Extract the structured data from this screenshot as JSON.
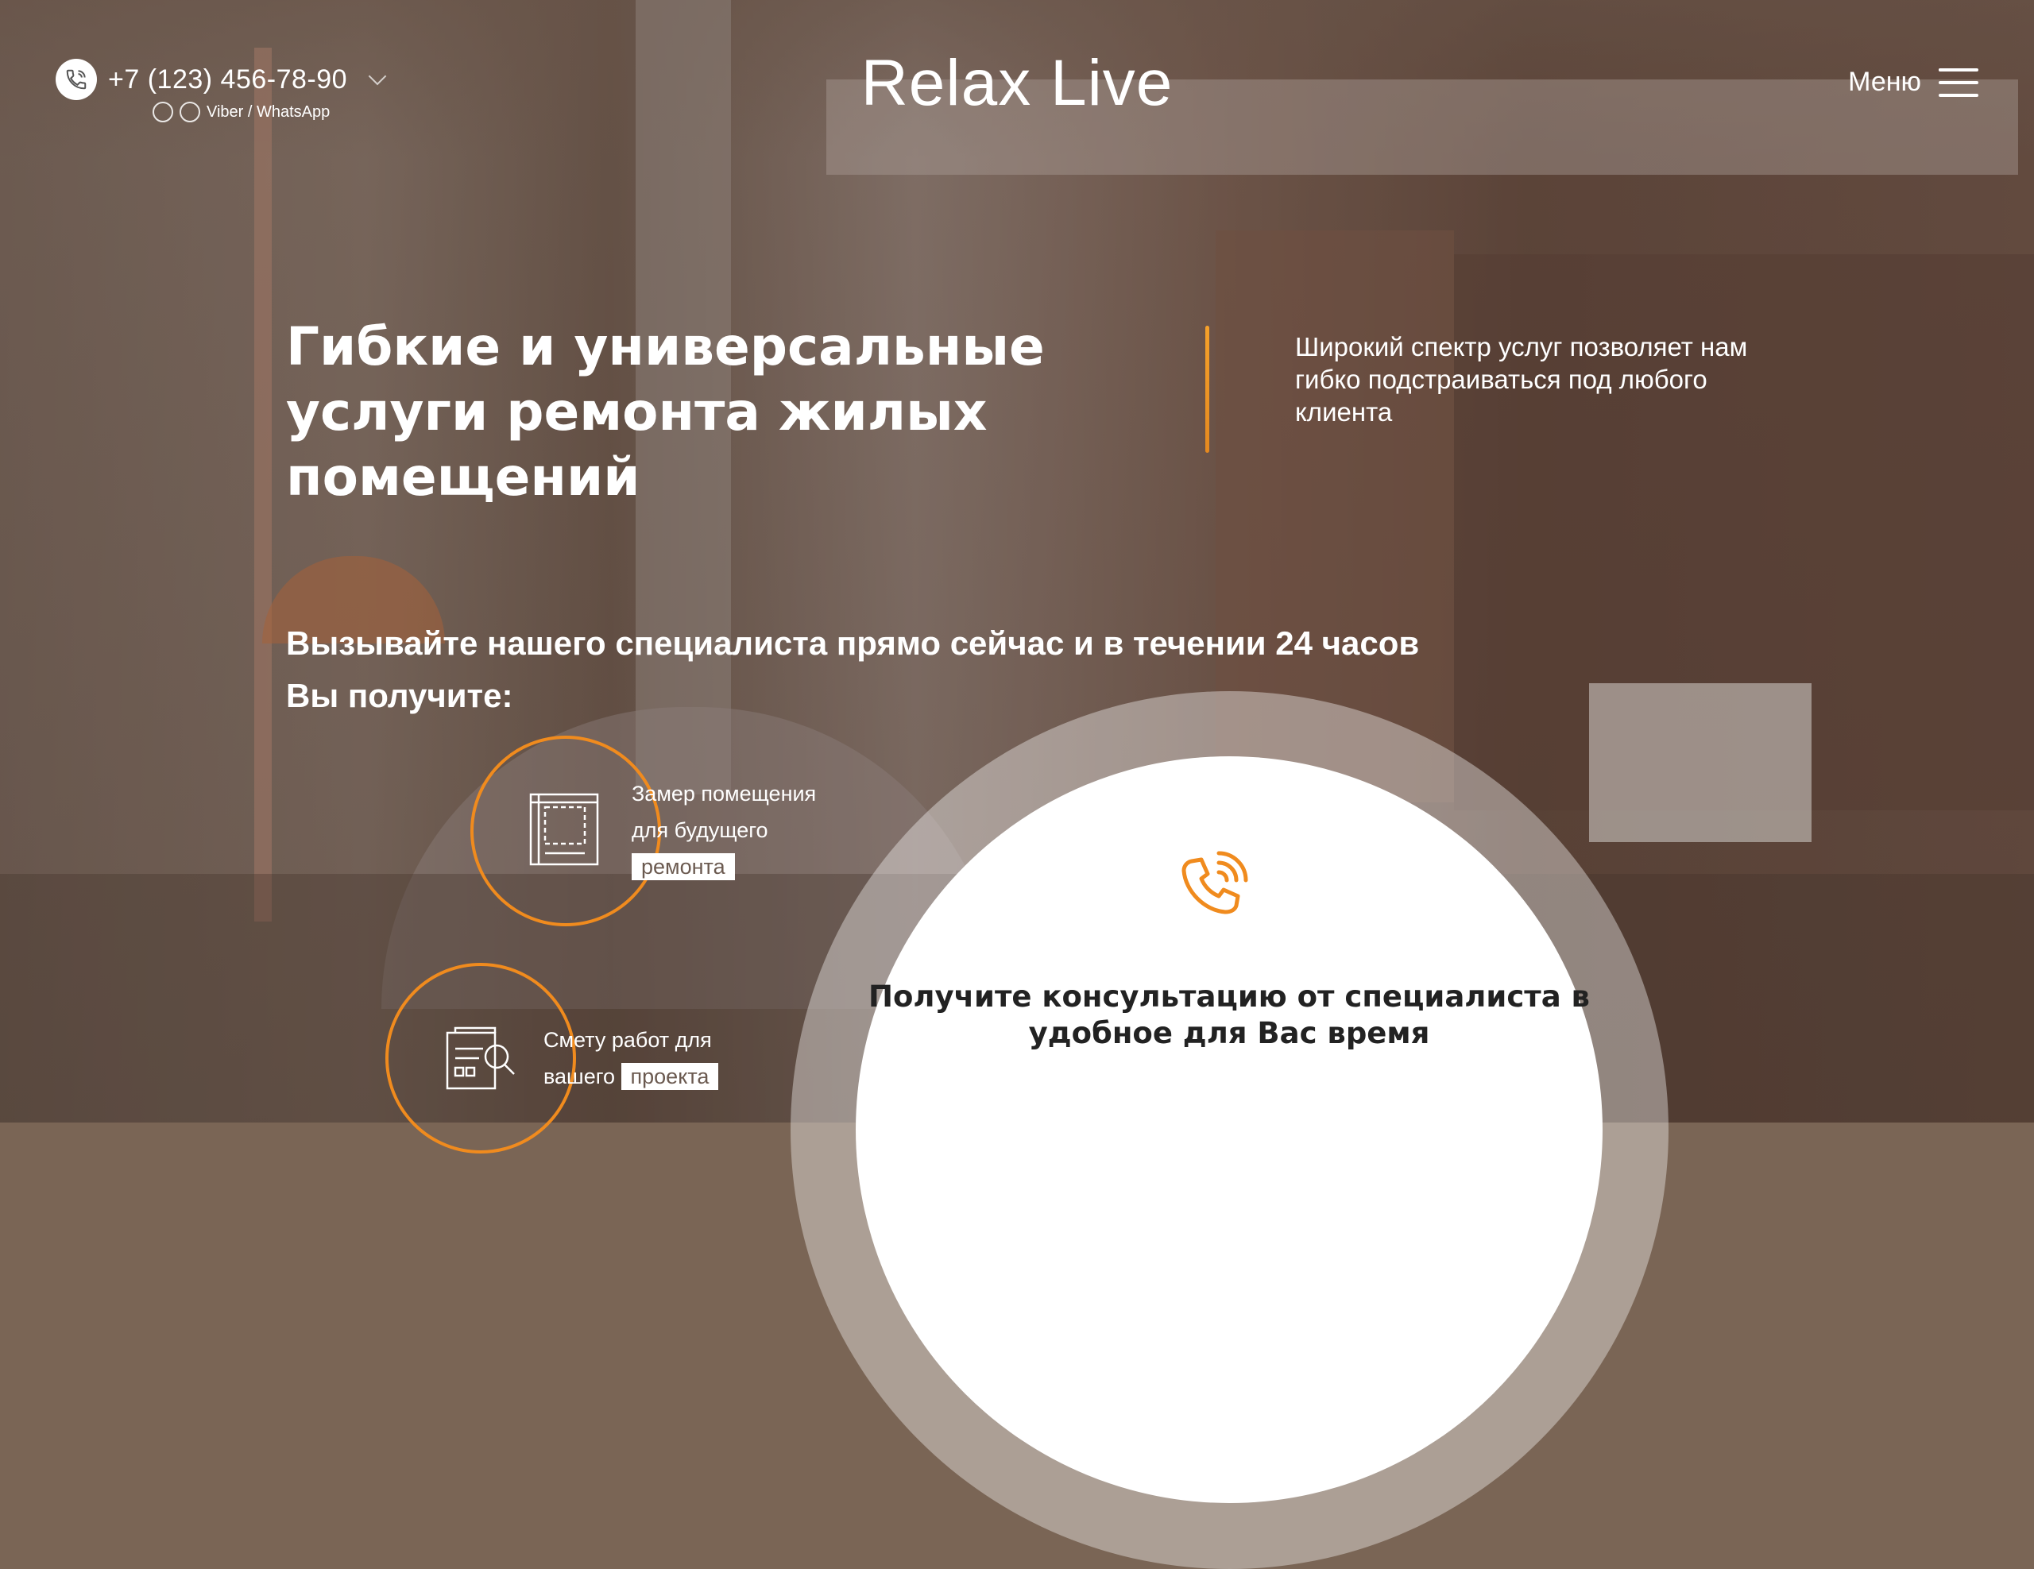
{
  "header": {
    "phone": "+7 (123) 456-78-90",
    "messengers_label": "Viber / WhatsApp",
    "logo": "Relax Live",
    "menu_label": "Меню"
  },
  "hero": {
    "title": "Гибкие и универсальные услуги ремонта жилых помещений",
    "description": "Широкий спектр услуг позволяет нам гибко подстраиваться под любого клиента",
    "cta_line": "Вызывайте нашего специалиста прямо сейчас и в течении 24 часов",
    "cta_sub": "Вы получите:"
  },
  "features": [
    {
      "text": "Замер помещения для будущего",
      "highlight": "ремонта",
      "icon": "blueprint-measure-icon"
    },
    {
      "text": "Смету работ для вашего",
      "highlight": "проекта",
      "icon": "estimate-plan-icon"
    }
  ],
  "consultation": {
    "icon": "phone-ringing-icon",
    "text": "Получите консультацию от специалиста в удобное для Вас время"
  },
  "colors": {
    "accent": "#f08b1e",
    "text_light": "#ffffff",
    "text_dark": "#222222"
  }
}
